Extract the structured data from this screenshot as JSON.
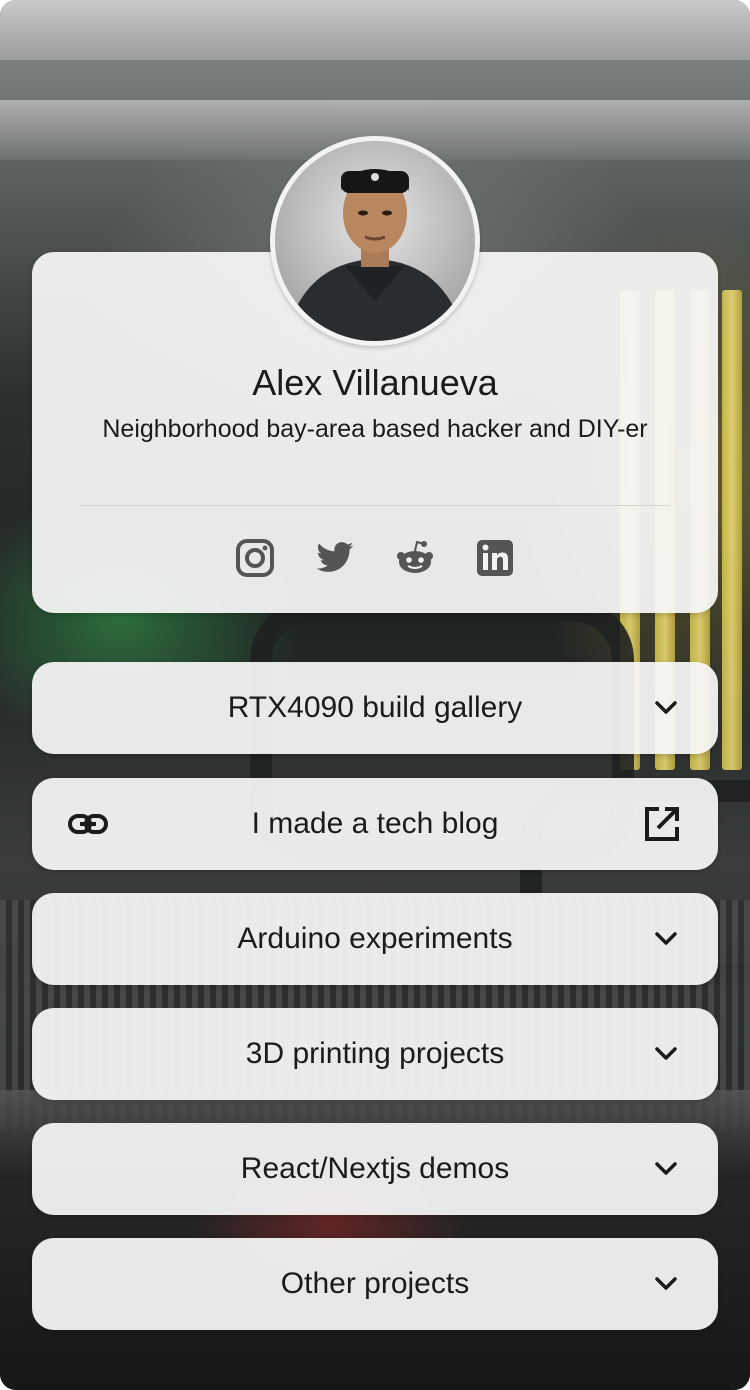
{
  "profile": {
    "name": "Alex Villanueva",
    "bio": "Neighborhood bay-area based hacker and DIY-er",
    "socials": [
      {
        "name": "instagram-icon"
      },
      {
        "name": "twitter-icon"
      },
      {
        "name": "reddit-icon"
      },
      {
        "name": "linkedin-icon"
      }
    ]
  },
  "links": [
    {
      "label": "RTX4090 build gallery",
      "type": "accordion",
      "icon": "chevron-down-icon"
    },
    {
      "label": "I made a tech blog",
      "type": "external",
      "left_icon": "link-icon",
      "right_icon": "external-link-icon"
    },
    {
      "label": "Arduino experiments",
      "type": "accordion",
      "icon": "chevron-down-icon"
    },
    {
      "label": "3D printing projects",
      "type": "accordion",
      "icon": "chevron-down-icon"
    },
    {
      "label": "React/Nextjs demos",
      "type": "accordion",
      "icon": "chevron-down-icon"
    },
    {
      "label": "Other projects",
      "type": "accordion",
      "icon": "chevron-down-icon"
    }
  ],
  "colors": {
    "card": "#f7f7f7",
    "text": "#1b1b1b",
    "icon": "#555555"
  }
}
